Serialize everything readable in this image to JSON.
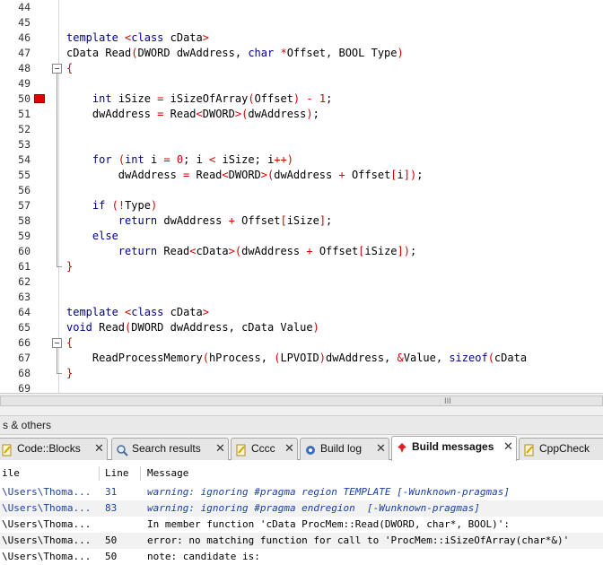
{
  "editor": {
    "lines": [
      {
        "n": "44",
        "code": ""
      },
      {
        "n": "45",
        "code": ""
      },
      {
        "n": "46",
        "code": "template <class cData>"
      },
      {
        "n": "47",
        "code": "cData Read(DWORD dwAddress, char *Offset, BOOL Type)"
      },
      {
        "n": "48",
        "code": "{"
      },
      {
        "n": "49",
        "code": ""
      },
      {
        "n": "50",
        "code": "    int iSize = iSizeOfArray(Offset) - 1;"
      },
      {
        "n": "51",
        "code": "    dwAddress = Read<DWORD>(dwAddress);"
      },
      {
        "n": "52",
        "code": ""
      },
      {
        "n": "53",
        "code": ""
      },
      {
        "n": "54",
        "code": "    for (int i = 0; i < iSize; i++)"
      },
      {
        "n": "55",
        "code": "        dwAddress = Read<DWORD>(dwAddress + Offset[i]);"
      },
      {
        "n": "56",
        "code": ""
      },
      {
        "n": "57",
        "code": "    if (!Type)"
      },
      {
        "n": "58",
        "code": "        return dwAddress + Offset[iSize];"
      },
      {
        "n": "59",
        "code": "    else"
      },
      {
        "n": "60",
        "code": "        return Read<cData>(dwAddress + Offset[iSize]);"
      },
      {
        "n": "61",
        "code": "}"
      },
      {
        "n": "62",
        "code": ""
      },
      {
        "n": "63",
        "code": ""
      },
      {
        "n": "64",
        "code": "template <class cData>"
      },
      {
        "n": "65",
        "code": "void Read(DWORD dwAddress, cData Value)"
      },
      {
        "n": "66",
        "code": "{"
      },
      {
        "n": "67",
        "code": "    ReadProcessMemory(hProcess, (LPVOID)dwAddress, &Value, sizeof(cData"
      },
      {
        "n": "68",
        "code": "}"
      },
      {
        "n": "69",
        "code": ""
      }
    ],
    "breakpoint_line": "50",
    "keyword_color": "#00008b",
    "operator_color": "#d00000"
  },
  "scrollbar": {
    "grip": "III"
  },
  "logs": {
    "title": "s & others",
    "tabs": [
      {
        "label": "Code::Blocks",
        "icon": "document-icon"
      },
      {
        "label": "Search results",
        "icon": "search-icon"
      },
      {
        "label": "Cccc",
        "icon": "document-icon"
      },
      {
        "label": "Build log",
        "icon": "gear-icon"
      },
      {
        "label": "Build messages",
        "icon": "pin-icon",
        "active": true
      },
      {
        "label": "CppCheck",
        "icon": "document-icon"
      }
    ],
    "close_glyph": "✕",
    "columns": {
      "file": "ile",
      "line": "Line",
      "message": "Message"
    },
    "rows": [
      {
        "file": "\\Users\\Thoma...",
        "line": "31",
        "message": "warning: ignoring #pragma region TEMPLATE [-Wunknown-pragmas]",
        "kind": "warn"
      },
      {
        "file": "\\Users\\Thoma...",
        "line": "83",
        "message": "warning: ignoring #pragma endregion  [-Wunknown-pragmas]",
        "kind": "warn"
      },
      {
        "file": "\\Users\\Thoma...",
        "line": "",
        "message": "In member function 'cData ProcMem::Read(DWORD, char*, BOOL)':",
        "kind": "norm"
      },
      {
        "file": "\\Users\\Thoma...",
        "line": "50",
        "message": "error: no matching function for call to 'ProcMem::iSizeOfArray(char*&)'",
        "kind": "norm"
      },
      {
        "file": "\\Users\\Thoma...",
        "line": "50",
        "message": "note: candidate is:",
        "kind": "norm"
      }
    ]
  }
}
